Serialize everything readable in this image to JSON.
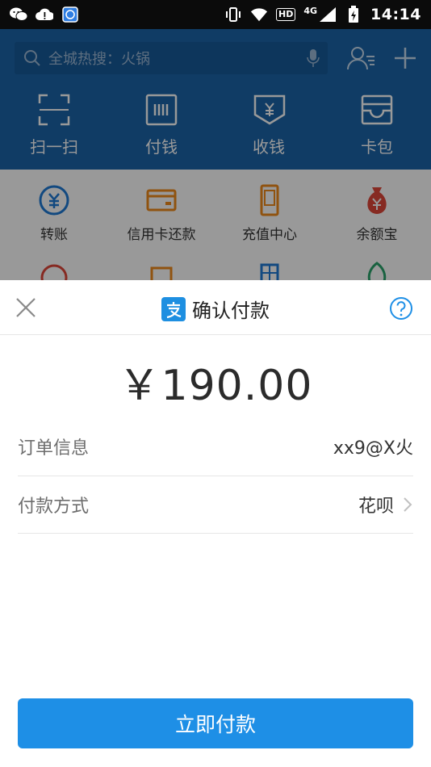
{
  "status_bar": {
    "time": "14:14",
    "network": "4G",
    "hd": "HD",
    "left_icons": [
      "wechat-icon",
      "alert-cloud-icon",
      "app-icon"
    ],
    "right_icons": [
      "vibrate-icon",
      "wifi-icon",
      "signal-icon",
      "battery-icon"
    ]
  },
  "header": {
    "search_placeholder": "全城热搜：火锅",
    "quick_actions": [
      {
        "label": "扫一扫",
        "icon": "scan-icon"
      },
      {
        "label": "付钱",
        "icon": "pay-code-icon"
      },
      {
        "label": "收钱",
        "icon": "receive-icon"
      },
      {
        "label": "卡包",
        "icon": "card-wallet-icon"
      }
    ]
  },
  "grid": {
    "items": [
      {
        "label": "转账",
        "icon": "transfer-icon"
      },
      {
        "label": "信用卡还款",
        "icon": "credit-card-icon"
      },
      {
        "label": "充值中心",
        "icon": "mobile-topup-icon"
      },
      {
        "label": "余额宝",
        "icon": "money-bag-icon"
      }
    ]
  },
  "sheet": {
    "title": "确认付款",
    "amount": "￥190.00",
    "order_label": "订单信息",
    "order_value": "xx9@X火",
    "method_label": "付款方式",
    "method_value": "花呗",
    "pay_button": "立即付款"
  },
  "colors": {
    "header_blue": "#1c64a8",
    "accent_blue": "#1e8fe6",
    "quick_icon_orange": "#f08a1c",
    "grid_blue": "#1e7bd6",
    "grid_red": "#e0473a"
  }
}
